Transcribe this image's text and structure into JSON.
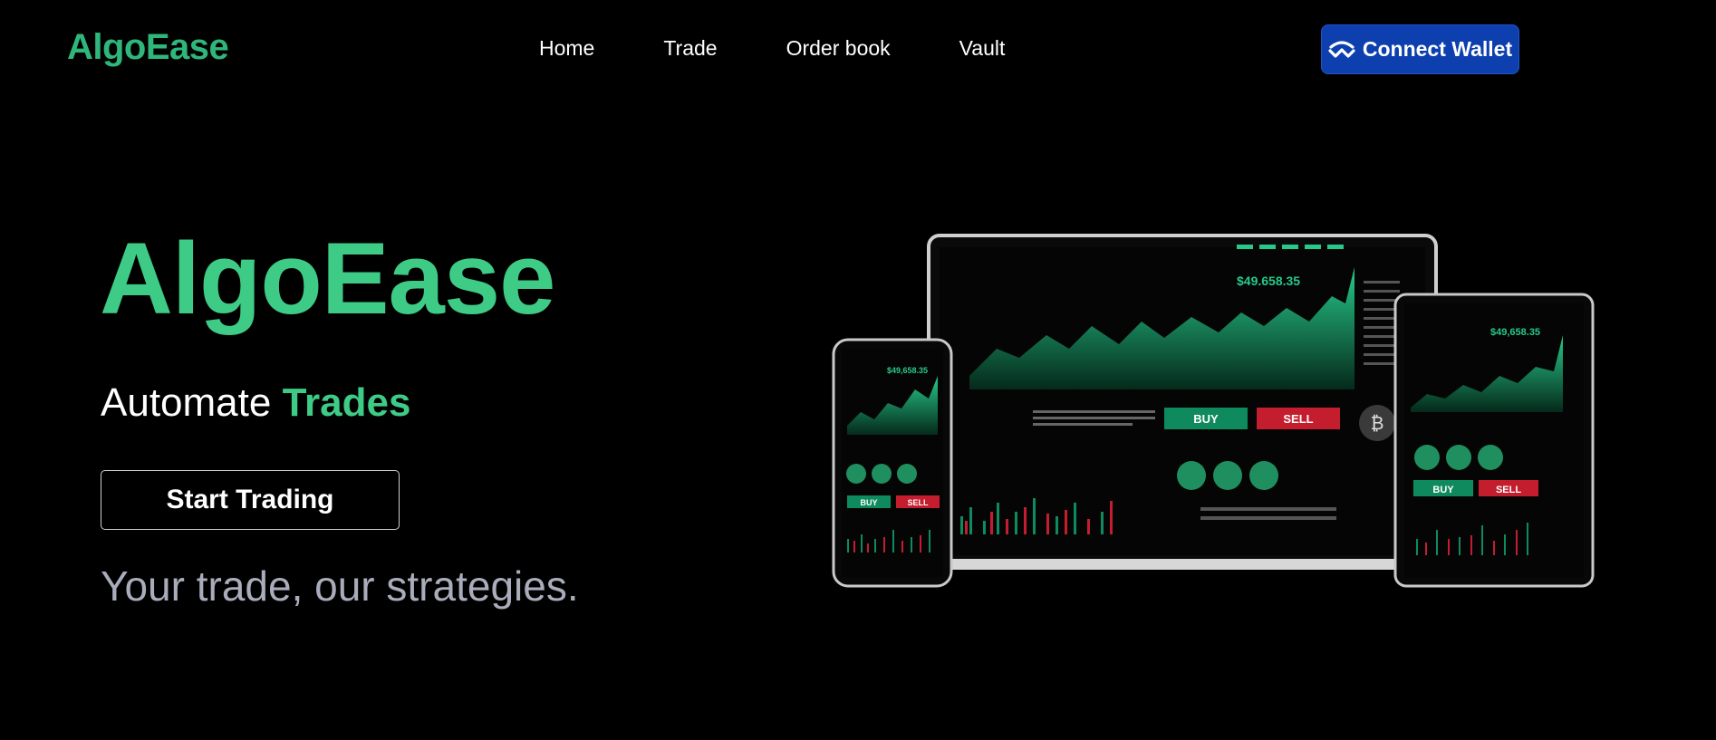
{
  "brand": {
    "logo": "AlgoEase"
  },
  "nav": {
    "links": [
      "Home",
      "Trade",
      "Order book",
      "Vault"
    ],
    "wallet_button": "Connect Wallet"
  },
  "hero": {
    "title": "AlgoEase",
    "subtitle_prefix": "Automate",
    "subtitle_accent": "Trades",
    "cta": "Start Trading",
    "tagline": "Your trade, our strategies."
  },
  "illustration": {
    "price": "$49.658.35",
    "buy_label": "BUY",
    "sell_label": "SELL",
    "small_price": "$49,658.35"
  },
  "colors": {
    "accent": "#3ecb86",
    "logo": "#2fb67a",
    "wallet_bg": "#0d3fae",
    "buy": "#0f8a5f",
    "sell": "#c41e2e",
    "background": "#000000",
    "tagline": "#a9acba"
  }
}
